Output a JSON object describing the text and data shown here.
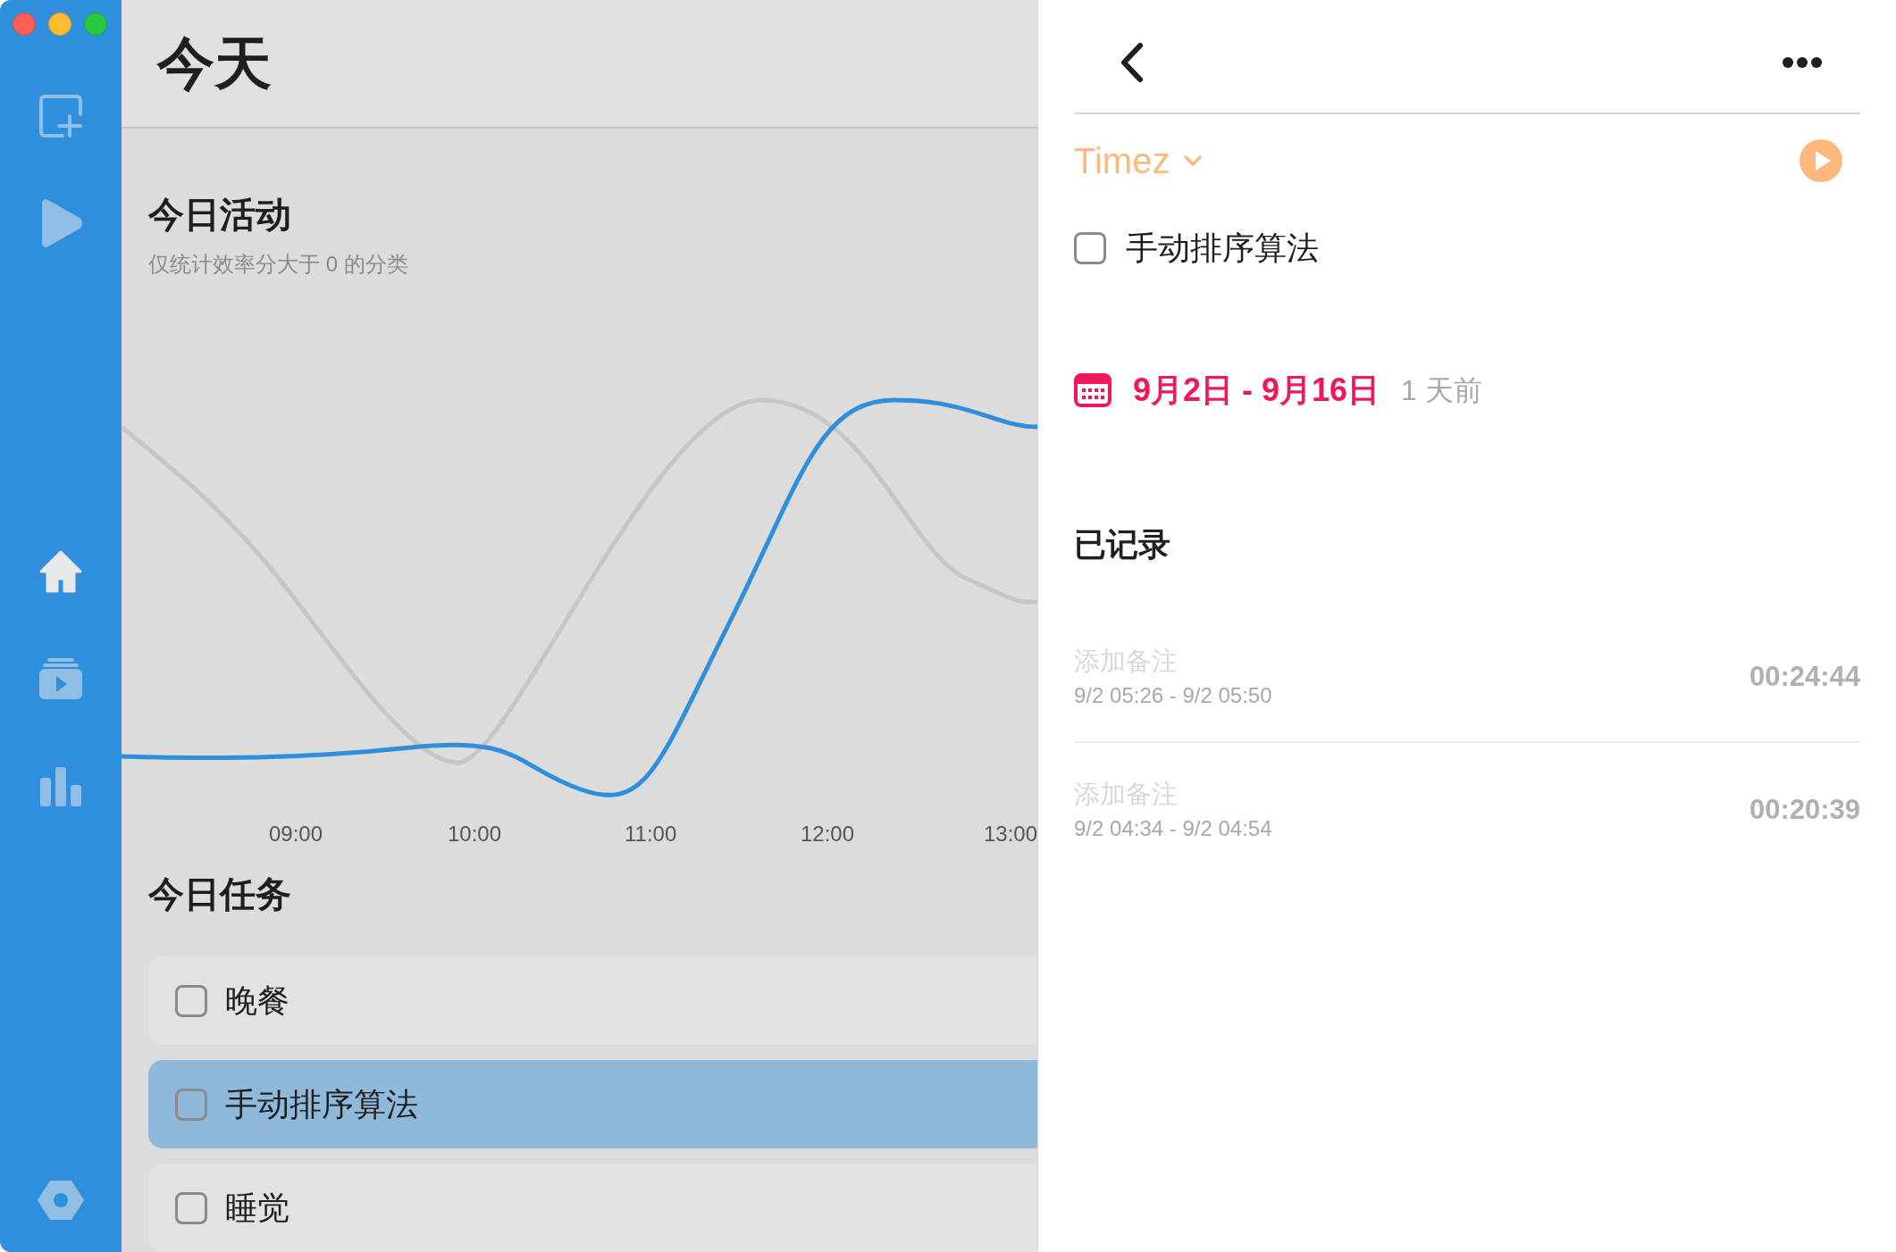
{
  "sidebar": {
    "items": [
      {
        "kind": "new-task",
        "selected": false
      },
      {
        "kind": "play",
        "selected": false
      },
      {
        "kind": "home",
        "selected": true
      },
      {
        "kind": "media",
        "selected": false
      },
      {
        "kind": "stats",
        "selected": false
      }
    ],
    "settings": {
      "kind": "settings"
    }
  },
  "main": {
    "title": "今天",
    "activity": {
      "title": "今日活动",
      "subtitle": "仅统计效率分大于 0 的分类",
      "x_labels": [
        "09:00",
        "10:00",
        "11:00",
        "12:00",
        "13:00"
      ]
    },
    "tasks": {
      "title": "今日任务",
      "items": [
        {
          "label": "晚餐",
          "checked": false,
          "selected": false
        },
        {
          "label": "手动排序算法",
          "checked": false,
          "selected": true
        },
        {
          "label": "睡觉",
          "checked": false,
          "selected": false
        }
      ]
    }
  },
  "detail": {
    "project": "Timez",
    "task": {
      "label": "手动排序算法",
      "checked": false
    },
    "date_range": "9月2日 - 9月16日",
    "relative": "1 天前",
    "records_title": "已记录",
    "records": [
      {
        "placeholder": "添加备注",
        "range": "9/2 05:26 - 9/2 05:50",
        "duration": "00:24:44"
      },
      {
        "placeholder": "添加备注",
        "range": "9/2 04:34 - 9/2 04:54",
        "duration": "00:20:39"
      }
    ]
  }
}
